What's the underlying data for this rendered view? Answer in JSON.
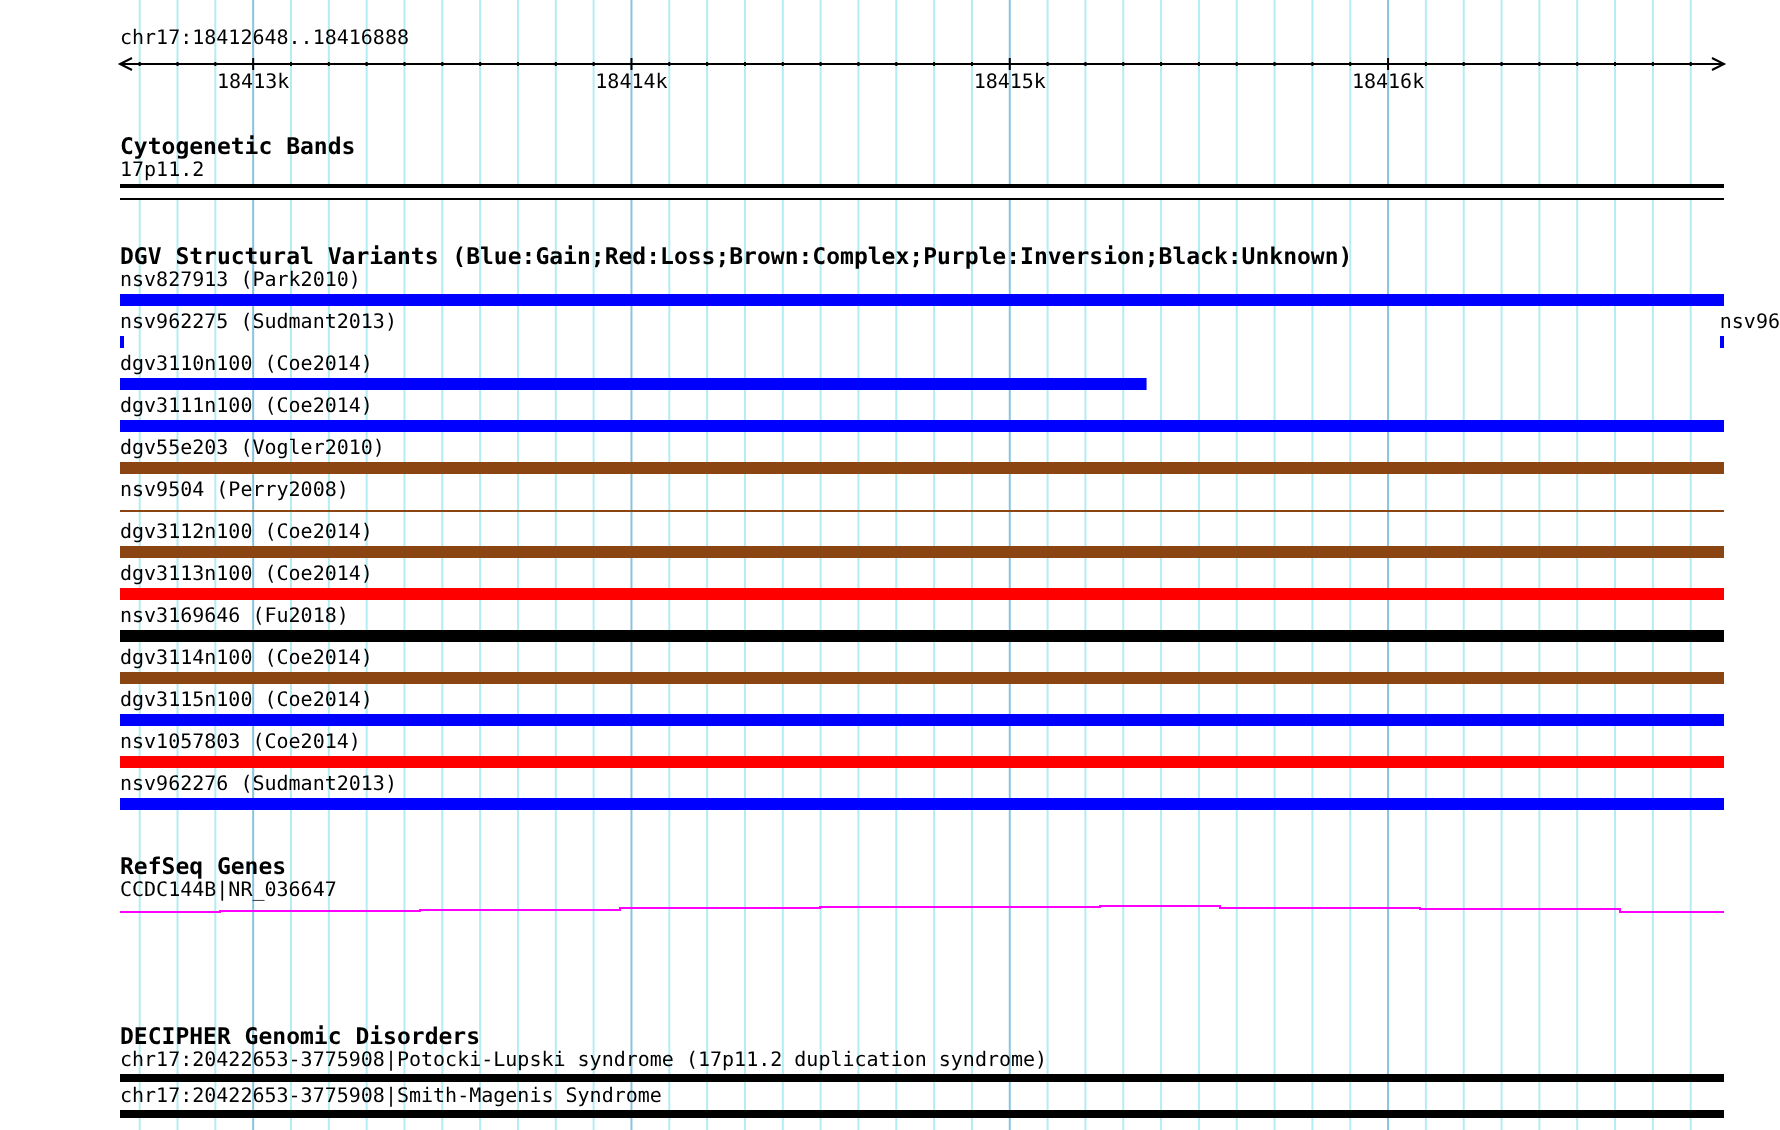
{
  "ruler": {
    "location": "chr17:18412648..18416888",
    "tick_labels": [
      "18413k",
      "18414k",
      "18415k",
      "18416k"
    ]
  },
  "tracks": [
    {
      "kind": "bands",
      "title": "Cytogenetic Bands",
      "features": [
        {
          "label": "17p11.2",
          "kind": "band"
        }
      ]
    },
    {
      "kind": "variants",
      "title": "DGV Structural Variants (Blue:Gain;Red:Loss;Brown:Complex;Purple:Inversion;Black:Unknown)",
      "features": [
        {
          "label": "nsv827913 (Park2010)",
          "kind": "bar",
          "color": "#0000ff",
          "level": 1
        },
        {
          "label": "nsv962275 (Sudmant2013)",
          "kind": "ticks",
          "color": "#0000ff",
          "side_label": "nsv96"
        },
        {
          "label": "dgv3110n100 (Coe2014)",
          "kind": "bar",
          "color": "#0000ff",
          "level": 0.64
        },
        {
          "label": "dgv3111n100 (Coe2014)",
          "kind": "bar",
          "color": "#0000ff",
          "level": 1
        },
        {
          "label": "dgv55e203 (Vogler2010)",
          "kind": "bar",
          "color": "#8b4513",
          "level": 1
        },
        {
          "label": "nsv9504 (Perry2008)",
          "kind": "line",
          "color": "#8b4513",
          "level": 1
        },
        {
          "label": "dgv3112n100 (Coe2014)",
          "kind": "bar",
          "color": "#8b4513",
          "level": 1
        },
        {
          "label": "dgv3113n100 (Coe2014)",
          "kind": "bar",
          "color": "#ff0000",
          "level": 1
        },
        {
          "label": "nsv3169646 (Fu2018)",
          "kind": "bar",
          "color": "#000000",
          "level": 1
        },
        {
          "label": "dgv3114n100 (Coe2014)",
          "kind": "bar",
          "color": "#8b4513",
          "level": 1
        },
        {
          "label": "dgv3115n100 (Coe2014)",
          "kind": "bar",
          "color": "#0000ff",
          "level": 1
        },
        {
          "label": "nsv1057803 (Coe2014)",
          "kind": "bar",
          "color": "#ff0000",
          "level": 1
        },
        {
          "label": "nsv962276 (Sudmant2013)",
          "kind": "bar",
          "color": "#0000ff",
          "level": 1
        }
      ]
    },
    {
      "kind": "genes",
      "title": "RefSeq Genes",
      "features": [
        {
          "label": "CCDC144B|NR_036647",
          "kind": "gene"
        }
      ]
    },
    {
      "kind": "disorders",
      "title": "DECIPHER Genomic Disorders",
      "features": [
        {
          "label": "chr17:20422653-3775908|Potocki-Lupski syndrome (17p11.2 duplication syndrome)",
          "kind": "bar",
          "color": "#000000",
          "level": 1
        },
        {
          "label": "chr17:20422653-3775908|Smith-Magenis Syndrome",
          "kind": "bar",
          "color": "#000000",
          "level": 1
        }
      ]
    }
  ]
}
